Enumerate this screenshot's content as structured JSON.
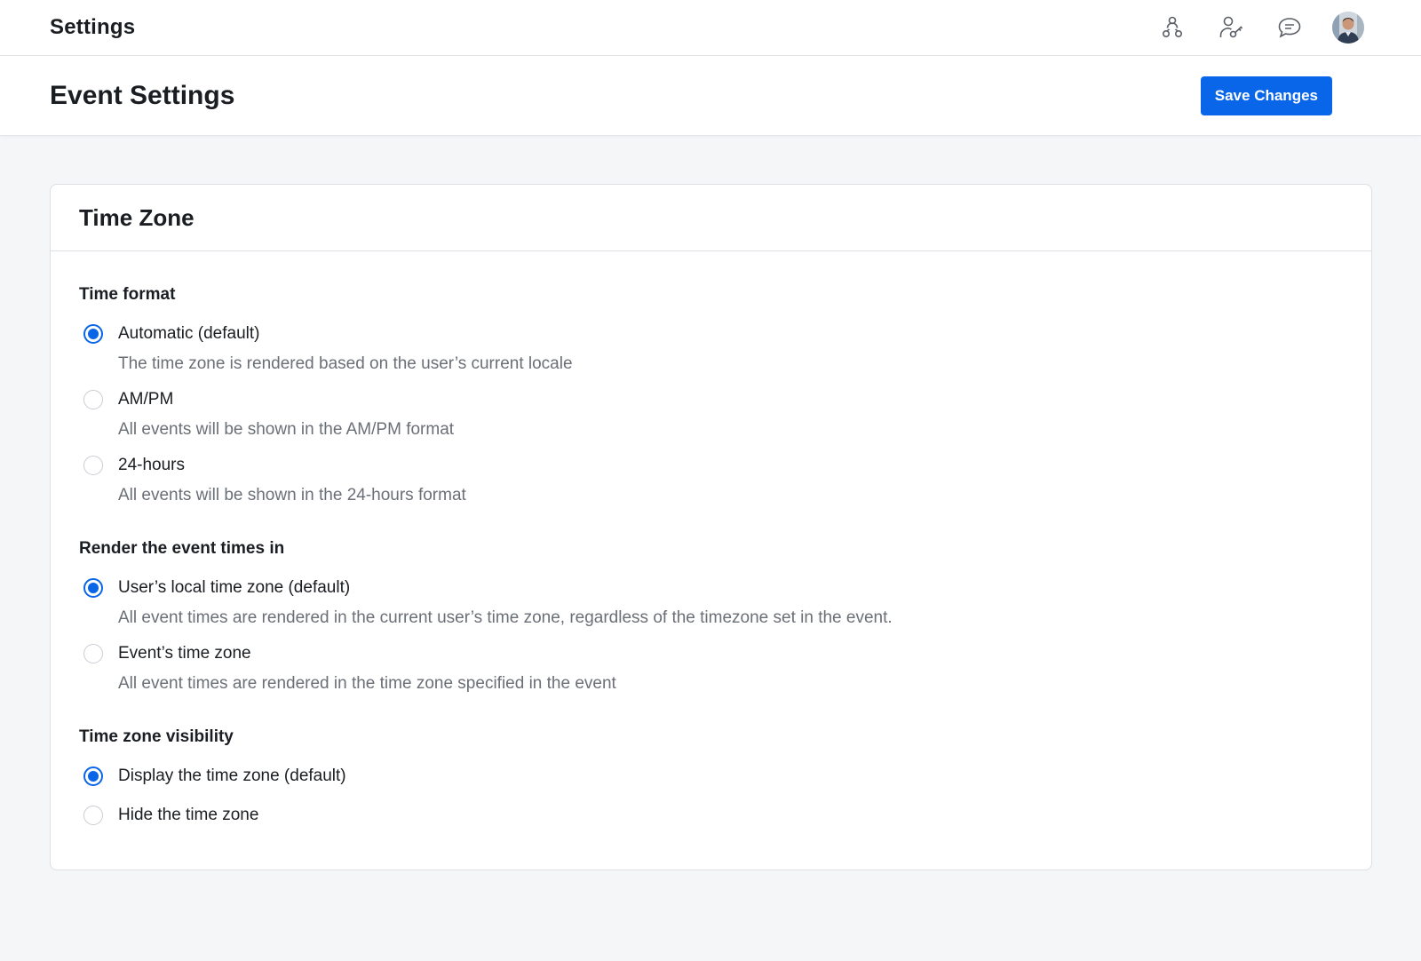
{
  "topbar": {
    "title": "Settings",
    "icons": [
      "people-group-icon",
      "user-key-icon",
      "chat-icon"
    ],
    "avatar": "user-avatar"
  },
  "page": {
    "title": "Event Settings",
    "save_label": "Save Changes"
  },
  "card": {
    "title": "Time Zone",
    "groups": [
      {
        "title": "Time format",
        "options": [
          {
            "label": "Automatic (default)",
            "description": "The time zone is rendered based on the user’s current locale",
            "checked": true
          },
          {
            "label": "AM/PM",
            "description": "All events will be shown in the AM/PM format",
            "checked": false
          },
          {
            "label": "24-hours",
            "description": "All events will be shown in the 24-hours format",
            "checked": false
          }
        ]
      },
      {
        "title": "Render the event times in",
        "options": [
          {
            "label": "User’s local time zone (default)",
            "description": "All event times are rendered in the current user’s time zone, regardless of the timezone set in the event.",
            "checked": true
          },
          {
            "label": "Event’s time zone",
            "description": "All event times are rendered in the time zone specified in the event",
            "checked": false
          }
        ]
      },
      {
        "title": "Time zone visibility",
        "options": [
          {
            "label": "Display the time zone (default)",
            "description": "",
            "checked": true
          },
          {
            "label": "Hide the time zone",
            "description": "",
            "checked": false
          }
        ]
      }
    ]
  },
  "colors": {
    "accent": "#0a66e8",
    "muted_text": "#6b6f76",
    "border": "#dcdfe3",
    "background": "#f5f6f8"
  }
}
